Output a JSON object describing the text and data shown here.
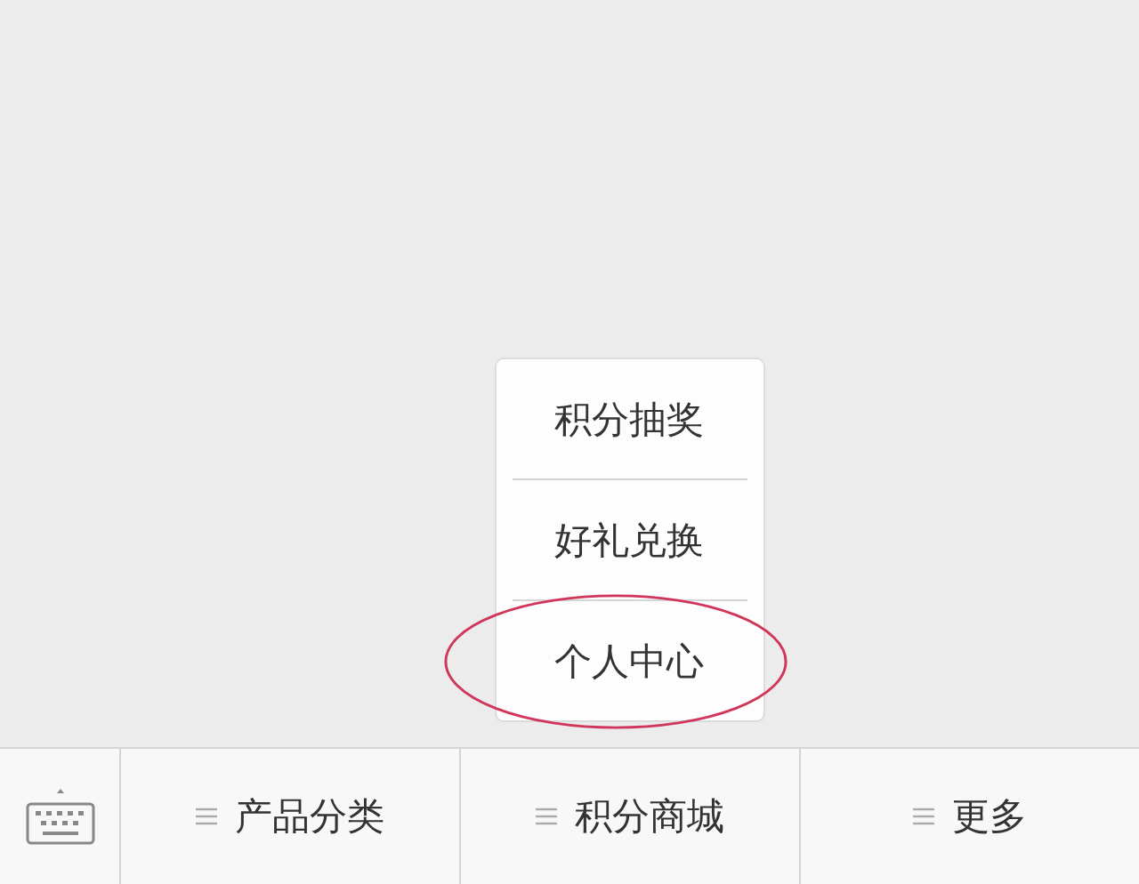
{
  "menus": [
    {
      "label": "产品分类",
      "expanded": false
    },
    {
      "label": "积分商城",
      "expanded": true,
      "submenu": [
        {
          "label": "积分抽奖",
          "circled": false
        },
        {
          "label": "好礼兑换",
          "circled": false
        },
        {
          "label": "个人中心",
          "circled": true
        }
      ]
    },
    {
      "label": "更多",
      "expanded": false
    }
  ]
}
